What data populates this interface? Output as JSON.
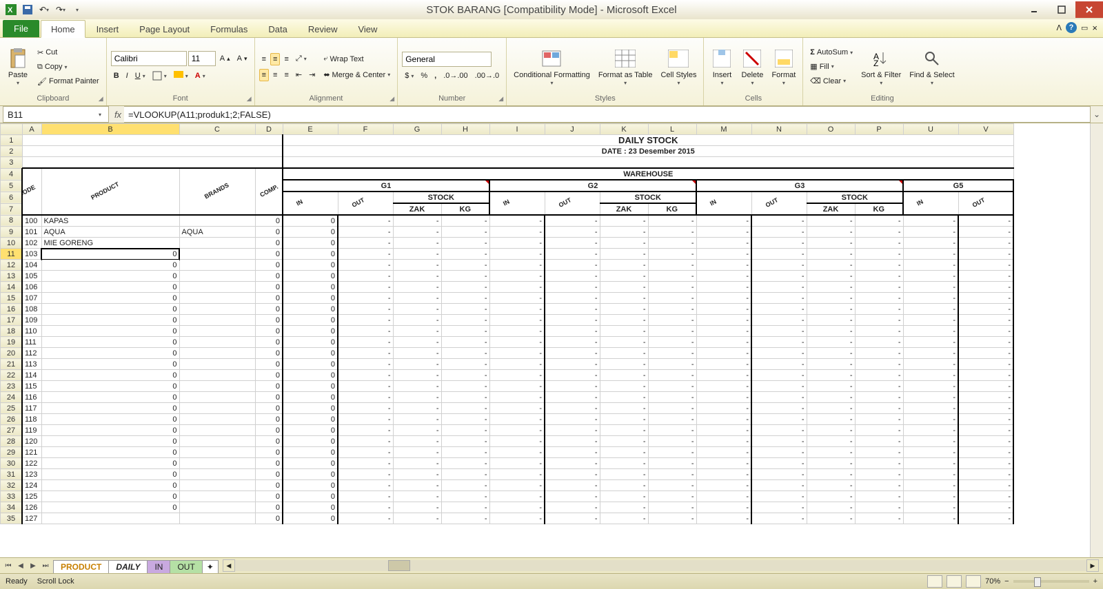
{
  "title": "STOK BARANG  [Compatibility Mode] - Microsoft Excel",
  "tabs": {
    "file": "File",
    "home": "Home",
    "insert": "Insert",
    "pagelayout": "Page Layout",
    "formulas": "Formulas",
    "data": "Data",
    "review": "Review",
    "view": "View"
  },
  "ribbon": {
    "clipboard": {
      "paste": "Paste",
      "cut": "Cut",
      "copy": "Copy",
      "fp": "Format Painter",
      "label": "Clipboard"
    },
    "font": {
      "name": "Calibri",
      "size": "11",
      "label": "Font"
    },
    "alignment": {
      "wrap": "Wrap Text",
      "merge": "Merge & Center",
      "label": "Alignment"
    },
    "number": {
      "format": "General",
      "label": "Number"
    },
    "styles": {
      "cf": "Conditional Formatting",
      "fat": "Format as Table",
      "cs": "Cell Styles",
      "label": "Styles"
    },
    "cells": {
      "insert": "Insert",
      "delete": "Delete",
      "format": "Format",
      "label": "Cells"
    },
    "editing": {
      "autosum": "AutoSum",
      "fill": "Fill",
      "clear": "Clear",
      "sort": "Sort & Filter",
      "find": "Find & Select",
      "label": "Editing"
    }
  },
  "namebox": "B11",
  "formula": "=VLOOKUP(A11;produk1;2;FALSE)",
  "sheet": {
    "title": "DAILY STOCK",
    "date": "DATE : 23 Desember 2015",
    "warehouse": "WAREHOUSE",
    "headers": {
      "code": "CODE",
      "product": "PRODUCT",
      "brands": "BRANDS",
      "comp": "COMP.",
      "in": "IN",
      "out": "OUT",
      "stock": "STOCK",
      "zak": "ZAK",
      "kg": "KG"
    },
    "g": [
      "G1",
      "G2",
      "G3",
      "G5"
    ],
    "cols": [
      "A",
      "B",
      "C",
      "D",
      "E",
      "F",
      "G",
      "H",
      "I",
      "J",
      "K",
      "L",
      "M",
      "N",
      "O",
      "P",
      "U",
      "V"
    ],
    "rows": [
      {
        "n": 8,
        "code": "100",
        "product": "KAPAS",
        "brand": "",
        "c": "0",
        "d": "0"
      },
      {
        "n": 9,
        "code": "101",
        "product": "AQUA",
        "brand": "AQUA",
        "c": "0",
        "d": "0"
      },
      {
        "n": 10,
        "code": "102",
        "product": "MIE GORENG",
        "brand": "",
        "c": "0",
        "d": "0"
      },
      {
        "n": 11,
        "code": "103",
        "product": "0",
        "brand": "",
        "c": "0",
        "d": "0",
        "sel": true
      },
      {
        "n": 12,
        "code": "104",
        "product": "0",
        "brand": "",
        "c": "0",
        "d": "0"
      },
      {
        "n": 13,
        "code": "105",
        "product": "0",
        "brand": "",
        "c": "0",
        "d": "0"
      },
      {
        "n": 14,
        "code": "106",
        "product": "0",
        "brand": "",
        "c": "0",
        "d": "0"
      },
      {
        "n": 15,
        "code": "107",
        "product": "0",
        "brand": "",
        "c": "0",
        "d": "0"
      },
      {
        "n": 16,
        "code": "108",
        "product": "0",
        "brand": "",
        "c": "0",
        "d": "0"
      },
      {
        "n": 17,
        "code": "109",
        "product": "0",
        "brand": "",
        "c": "0",
        "d": "0"
      },
      {
        "n": 18,
        "code": "110",
        "product": "0",
        "brand": "",
        "c": "0",
        "d": "0"
      },
      {
        "n": 19,
        "code": "111",
        "product": "0",
        "brand": "",
        "c": "0",
        "d": "0"
      },
      {
        "n": 20,
        "code": "112",
        "product": "0",
        "brand": "",
        "c": "0",
        "d": "0"
      },
      {
        "n": 21,
        "code": "113",
        "product": "0",
        "brand": "",
        "c": "0",
        "d": "0"
      },
      {
        "n": 22,
        "code": "114",
        "product": "0",
        "brand": "",
        "c": "0",
        "d": "0"
      },
      {
        "n": 23,
        "code": "115",
        "product": "0",
        "brand": "",
        "c": "0",
        "d": "0"
      },
      {
        "n": 24,
        "code": "116",
        "product": "0",
        "brand": "",
        "c": "0",
        "d": "0"
      },
      {
        "n": 25,
        "code": "117",
        "product": "0",
        "brand": "",
        "c": "0",
        "d": "0"
      },
      {
        "n": 26,
        "code": "118",
        "product": "0",
        "brand": "",
        "c": "0",
        "d": "0"
      },
      {
        "n": 27,
        "code": "119",
        "product": "0",
        "brand": "",
        "c": "0",
        "d": "0"
      },
      {
        "n": 28,
        "code": "120",
        "product": "0",
        "brand": "",
        "c": "0",
        "d": "0"
      },
      {
        "n": 29,
        "code": "121",
        "product": "0",
        "brand": "",
        "c": "0",
        "d": "0"
      },
      {
        "n": 30,
        "code": "122",
        "product": "0",
        "brand": "",
        "c": "0",
        "d": "0"
      },
      {
        "n": 31,
        "code": "123",
        "product": "0",
        "brand": "",
        "c": "0",
        "d": "0"
      },
      {
        "n": 32,
        "code": "124",
        "product": "0",
        "brand": "",
        "c": "0",
        "d": "0"
      },
      {
        "n": 33,
        "code": "125",
        "product": "0",
        "brand": "",
        "c": "0",
        "d": "0"
      },
      {
        "n": 34,
        "code": "126",
        "product": "0",
        "brand": "",
        "c": "0",
        "d": "0"
      },
      {
        "n": 35,
        "code": "127",
        "product": "",
        "brand": "",
        "c": "0",
        "d": "0"
      }
    ]
  },
  "sheettabs": {
    "product": "PRODUCT",
    "daily": "DAILY",
    "in": "IN",
    "out": "OUT"
  },
  "status": {
    "ready": "Ready",
    "scroll": "Scroll Lock",
    "zoom": "70%"
  }
}
